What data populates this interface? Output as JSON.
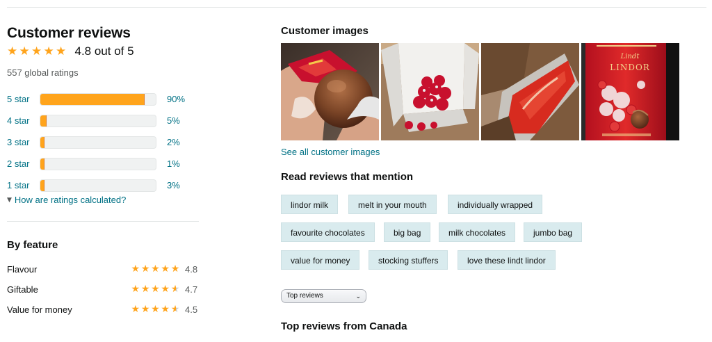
{
  "reviews": {
    "title": "Customer reviews",
    "rating_value": 4.8,
    "rating_text": "4.8 out of 5",
    "global_ratings": "557 global ratings",
    "histogram": [
      {
        "label": "5 star",
        "percent": 90,
        "percent_text": "90%"
      },
      {
        "label": "4 star",
        "percent": 5,
        "percent_text": "5%"
      },
      {
        "label": "3 star",
        "percent": 2,
        "percent_text": "2%"
      },
      {
        "label": "2 star",
        "percent": 1,
        "percent_text": "1%"
      },
      {
        "label": "1 star",
        "percent": 3,
        "percent_text": "3%"
      }
    ],
    "how_calculated": "How are ratings calculated?",
    "by_feature_title": "By feature",
    "features": [
      {
        "name": "Flavour",
        "rating": 4.8,
        "rating_text": "4.8"
      },
      {
        "name": "Giftable",
        "rating": 4.7,
        "rating_text": "4.7"
      },
      {
        "name": "Value for money",
        "rating": 4.5,
        "rating_text": "4.5"
      }
    ]
  },
  "customer_images": {
    "title": "Customer images",
    "images": [
      {
        "name": "chocolate-ball-in-hand"
      },
      {
        "name": "box-of-wrapped-chocolates"
      },
      {
        "name": "red-package-in-box"
      },
      {
        "name": "lindor-bag"
      }
    ],
    "bag_brand": "Lindt",
    "bag_label": "LINDOR",
    "see_all": "See all customer images"
  },
  "mentions": {
    "title": "Read reviews that mention",
    "chips": [
      "lindor milk",
      "melt in your mouth",
      "individually wrapped",
      "favourite chocolates",
      "big bag",
      "milk chocolates",
      "jumbo bag",
      "value for money",
      "stocking stuffers",
      "love these lindt lindor"
    ]
  },
  "sort": {
    "selected": "Top reviews"
  },
  "top_reviews_title": "Top reviews from Canada",
  "colors": {
    "star": "#ffa41c",
    "link": "#007185",
    "chip": "#d9ebee"
  },
  "icons": {
    "star": "star-icon",
    "chevron": "chevron-down-icon"
  }
}
